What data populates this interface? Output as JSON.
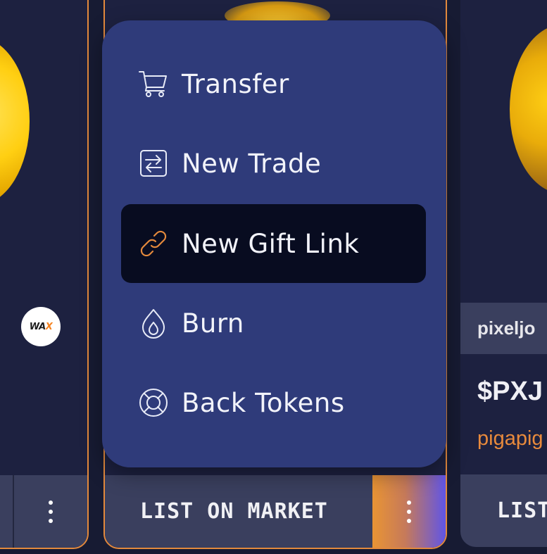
{
  "left_card": {
    "badge": "WAX"
  },
  "middle_card": {
    "list_button_label": "LIST ON MARKET",
    "more_button_label": "⋮"
  },
  "right_card": {
    "collection_tag": "pixeljo",
    "price": "$PXJ",
    "author": "pigapig",
    "list_button_label": "LIST"
  },
  "menu": {
    "items": [
      {
        "label": "Transfer",
        "icon": "cart-icon"
      },
      {
        "label": "New Trade",
        "icon": "swap-icon"
      },
      {
        "label": "New Gift Link",
        "icon": "link-icon",
        "active": true
      },
      {
        "label": "Burn",
        "icon": "flame-icon"
      },
      {
        "label": "Back Tokens",
        "icon": "lifebuoy-icon"
      }
    ]
  },
  "colors": {
    "accent_orange": "#e3893c",
    "menu_bg": "#2f3b7a",
    "menu_active_bg": "#080c20",
    "gradient_end": "#6055e6"
  }
}
